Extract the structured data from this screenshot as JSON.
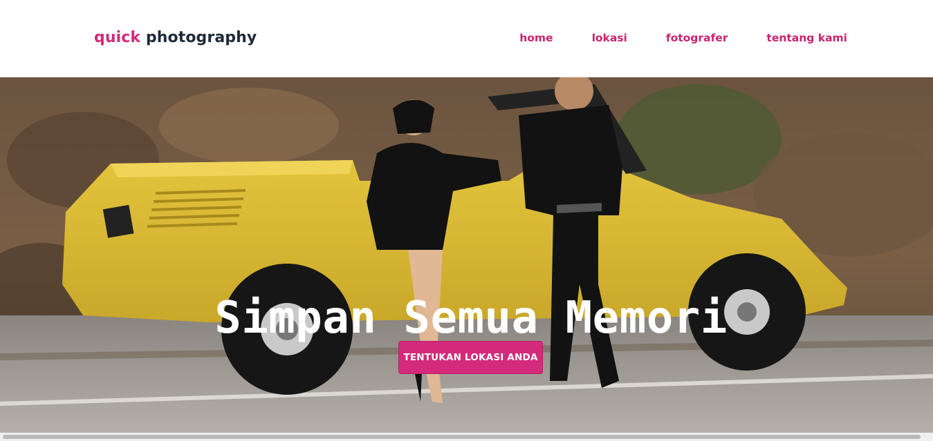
{
  "brand": {
    "accent": "quick",
    "rest": "photography"
  },
  "nav": {
    "items": [
      {
        "label": "home"
      },
      {
        "label": "lokasi"
      },
      {
        "label": "fotografer"
      },
      {
        "label": "tentang kami"
      }
    ]
  },
  "hero": {
    "title": "Simpan Semua Memori",
    "button_label": "TENTUKAN LOKASI ANDA",
    "image": "couple posing beside a yellow vintage car"
  },
  "colors": {
    "accent": "#d42a7b",
    "brand_text": "#1f2a3a",
    "nav_link": "#c8246f",
    "background": "#ffffff"
  },
  "scrollbar": {
    "orientation": "horizontal"
  }
}
